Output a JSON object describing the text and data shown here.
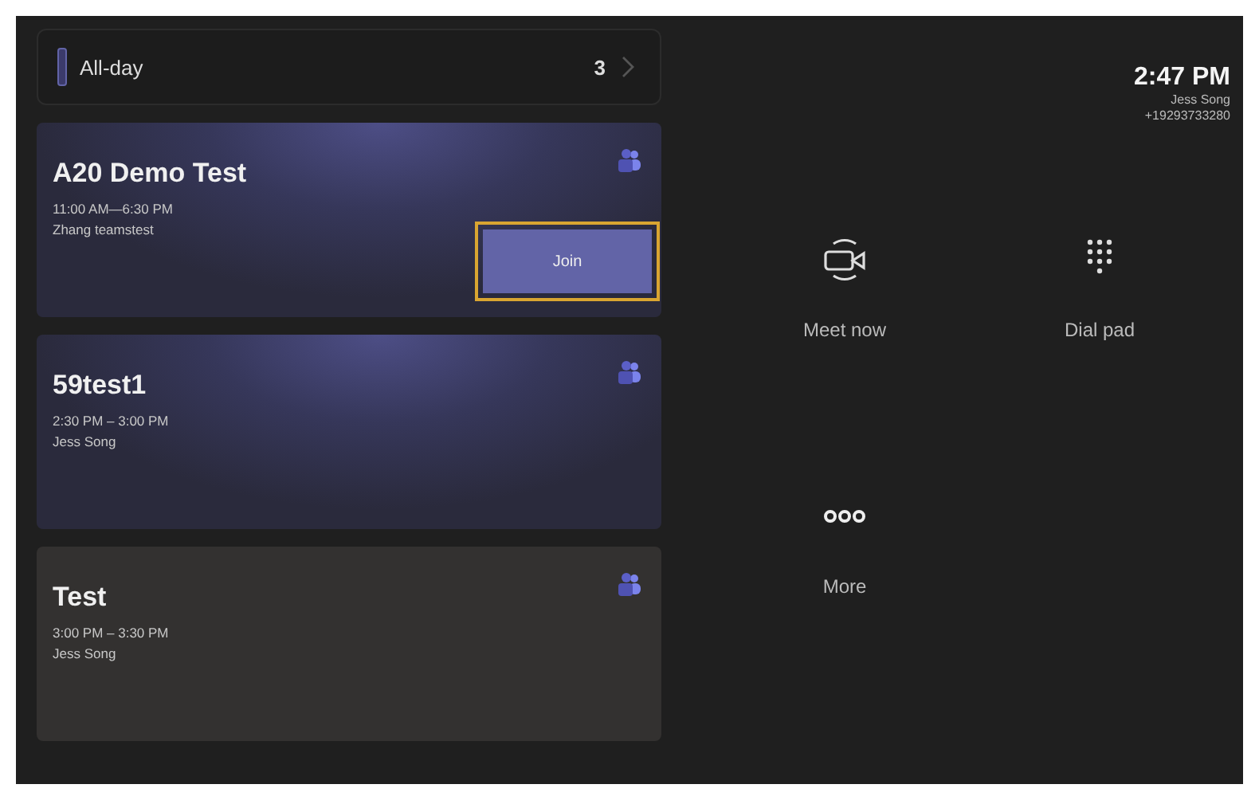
{
  "all_day": {
    "label": "All-day",
    "count": "3"
  },
  "meetings": [
    {
      "title": "A20 Demo Test",
      "time": "11:00 AM—6:30 PM",
      "organizer": "Zhang teamstest",
      "highlighted": true,
      "join_button": {
        "label": "Join",
        "focused": true
      }
    },
    {
      "title": "59test1",
      "time": "2:30 PM – 3:00 PM",
      "organizer": "Jess Song",
      "highlighted": true
    },
    {
      "title": "Test",
      "time": "3:00 PM – 3:30 PM",
      "organizer": "Jess Song",
      "highlighted": false
    }
  ],
  "header": {
    "time": "2:47 PM",
    "user": "Jess Song",
    "phone": "+19293733280"
  },
  "actions": [
    {
      "kind": "meet",
      "label": "Meet now"
    },
    {
      "kind": "dialpad",
      "label": "Dial pad"
    },
    {
      "kind": "more",
      "label": "More"
    }
  ]
}
